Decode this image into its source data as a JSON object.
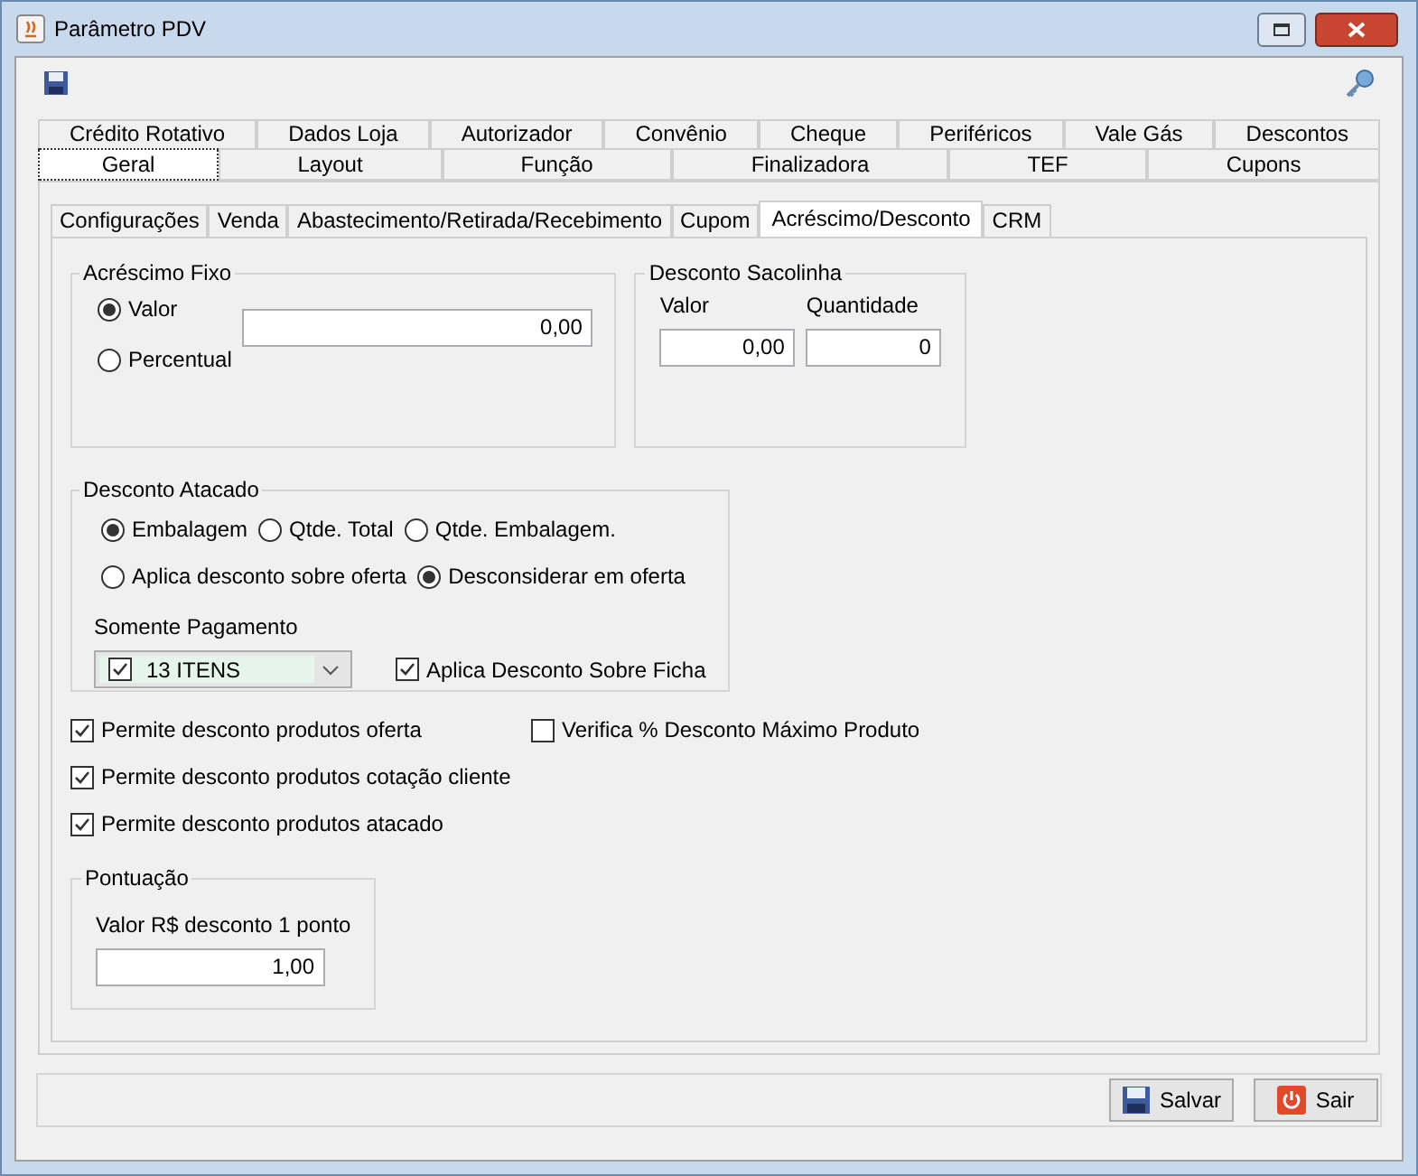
{
  "window": {
    "title": "Parâmetro PDV"
  },
  "tabs_row_1": [
    {
      "label": "Crédito Rotativo",
      "selected": false
    },
    {
      "label": "Dados Loja",
      "selected": false
    },
    {
      "label": "Autorizador",
      "selected": false
    },
    {
      "label": "Convênio",
      "selected": false
    },
    {
      "label": "Cheque",
      "selected": false
    },
    {
      "label": "Periféricos",
      "selected": false
    },
    {
      "label": "Vale Gás",
      "selected": false
    },
    {
      "label": "Descontos",
      "selected": false
    }
  ],
  "tabs_row_2": [
    {
      "label": "Geral",
      "selected": true
    },
    {
      "label": "Layout",
      "selected": false
    },
    {
      "label": "Função",
      "selected": false
    },
    {
      "label": "Finalizadora",
      "selected": false
    },
    {
      "label": "TEF",
      "selected": false
    },
    {
      "label": "Cupons",
      "selected": false
    }
  ],
  "subtabs": [
    {
      "label": "Configurações",
      "selected": false
    },
    {
      "label": "Venda",
      "selected": false
    },
    {
      "label": "Abastecimento/Retirada/Recebimento",
      "selected": false
    },
    {
      "label": "Cupom",
      "selected": false
    },
    {
      "label": "Acréscimo/Desconto",
      "selected": true
    },
    {
      "label": "CRM",
      "selected": false
    }
  ],
  "acrescimo_fixo": {
    "title": "Acréscimo Fixo",
    "options": [
      {
        "label": "Valor",
        "selected": true
      },
      {
        "label": "Percentual",
        "selected": false
      }
    ],
    "value": "0,00"
  },
  "desconto_sacolinha": {
    "title": "Desconto Sacolinha",
    "fields": [
      {
        "label": "Valor",
        "value": "0,00"
      },
      {
        "label": "Quantidade",
        "value": "0"
      }
    ]
  },
  "desconto_atacado": {
    "title": "Desconto Atacado",
    "mode_options": [
      {
        "label": "Embalagem",
        "selected": true
      },
      {
        "label": "Qtde. Total",
        "selected": false
      },
      {
        "label": "Qtde. Embalagem.",
        "selected": false
      }
    ],
    "offer_options": [
      {
        "label": "Aplica desconto sobre oferta",
        "selected": false
      },
      {
        "label": "Desconsiderar em oferta",
        "selected": true
      }
    ],
    "somente_pagamento": {
      "label": "Somente Pagamento",
      "checked": true,
      "value": "13 ITENS"
    },
    "aplica_ficha": {
      "label": "Aplica Desconto Sobre Ficha",
      "checked": true
    }
  },
  "checkboxes_left": [
    {
      "label": "Permite desconto produtos oferta",
      "checked": true
    },
    {
      "label": "Permite desconto produtos cotação cliente",
      "checked": true
    },
    {
      "label": "Permite desconto produtos atacado",
      "checked": true
    }
  ],
  "checkboxes_right": [
    {
      "label": "Verifica % Desconto Máximo Produto",
      "checked": false
    }
  ],
  "pontuacao": {
    "title": "Pontuação",
    "label": "Valor R$ desconto 1 ponto",
    "value": "1,00"
  },
  "buttons": [
    {
      "kind": "save",
      "label": "Salvar"
    },
    {
      "kind": "exit",
      "label": "Sair"
    }
  ]
}
